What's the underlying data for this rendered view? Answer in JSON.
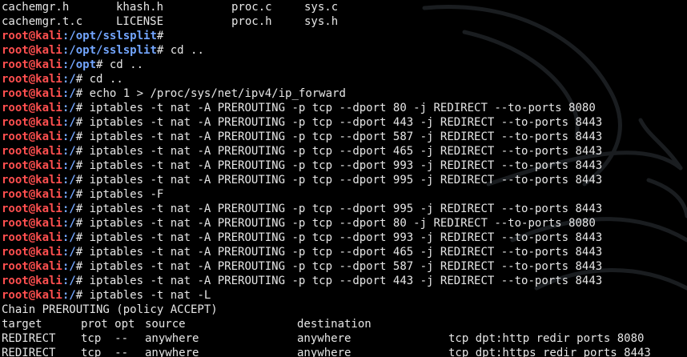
{
  "ls_rows": [
    [
      "cachemgr.h",
      "khash.h",
      "proc.c",
      "sys.c"
    ],
    [
      "cachemgr.t.c",
      "LICENSE",
      "proc.h",
      "sys.h"
    ]
  ],
  "prompt_user_host": "root@kali",
  "prompt_lines": [
    {
      "path": "/opt/sslsplit",
      "cmd": ""
    },
    {
      "path": "/opt/sslsplit",
      "cmd": " cd .."
    },
    {
      "path": "/opt",
      "cmd": " cd .."
    },
    {
      "path": "/",
      "cmd": " cd .."
    },
    {
      "path": "/",
      "cmd": " echo 1 > /proc/sys/net/ipv4/ip_forward"
    },
    {
      "path": "/",
      "cmd": " iptables -t nat -A PREROUTING -p tcp --dport 80 -j REDIRECT --to-ports 8080"
    },
    {
      "path": "/",
      "cmd": " iptables -t nat -A PREROUTING -p tcp --dport 443 -j REDIRECT --to-ports 8443"
    },
    {
      "path": "/",
      "cmd": " iptables -t nat -A PREROUTING -p tcp --dport 587 -j REDIRECT --to-ports 8443"
    },
    {
      "path": "/",
      "cmd": " iptables -t nat -A PREROUTING -p tcp --dport 465 -j REDIRECT --to-ports 8443"
    },
    {
      "path": "/",
      "cmd": " iptables -t nat -A PREROUTING -p tcp --dport 993 -j REDIRECT --to-ports 8443"
    },
    {
      "path": "/",
      "cmd": " iptables -t nat -A PREROUTING -p tcp --dport 995 -j REDIRECT --to-ports 8443"
    },
    {
      "path": "/",
      "cmd": " iptables -F"
    },
    {
      "path": "/",
      "cmd": " iptables -t nat -A PREROUTING -p tcp --dport 995 -j REDIRECT --to-ports 8443"
    },
    {
      "path": "/",
      "cmd": " iptables -t nat -A PREROUTING -p tcp --dport 80 -j REDIRECT --to-ports 8080"
    },
    {
      "path": "/",
      "cmd": " iptables -t nat -A PREROUTING -p tcp --dport 993 -j REDIRECT --to-ports 8443"
    },
    {
      "path": "/",
      "cmd": " iptables -t nat -A PREROUTING -p tcp --dport 465 -j REDIRECT --to-ports 8443"
    },
    {
      "path": "/",
      "cmd": " iptables -t nat -A PREROUTING -p tcp --dport 587 -j REDIRECT --to-ports 8443"
    },
    {
      "path": "/",
      "cmd": " iptables -t nat -A PREROUTING -p tcp --dport 443 -j REDIRECT --to-ports 8443"
    },
    {
      "path": "/",
      "cmd": " iptables -t nat -L"
    }
  ],
  "chain_header": "Chain PREROUTING (policy ACCEPT)",
  "table_header": [
    "target",
    "prot opt",
    "source",
    "destination",
    ""
  ],
  "table_rows": [
    [
      "REDIRECT",
      "tcp  --",
      "anywhere",
      "anywhere",
      "tcp dpt:http redir ports 8080"
    ],
    [
      "REDIRECT",
      "tcp  --",
      "anywhere",
      "anywhere",
      "tcp dpt:https redir ports 8443"
    ]
  ],
  "colors": {
    "background": "#000000",
    "text": "#e6e6e6",
    "user_host": "#ff4f4f",
    "path": "#73a6ff"
  },
  "background_icon": "kali-dragon-icon"
}
